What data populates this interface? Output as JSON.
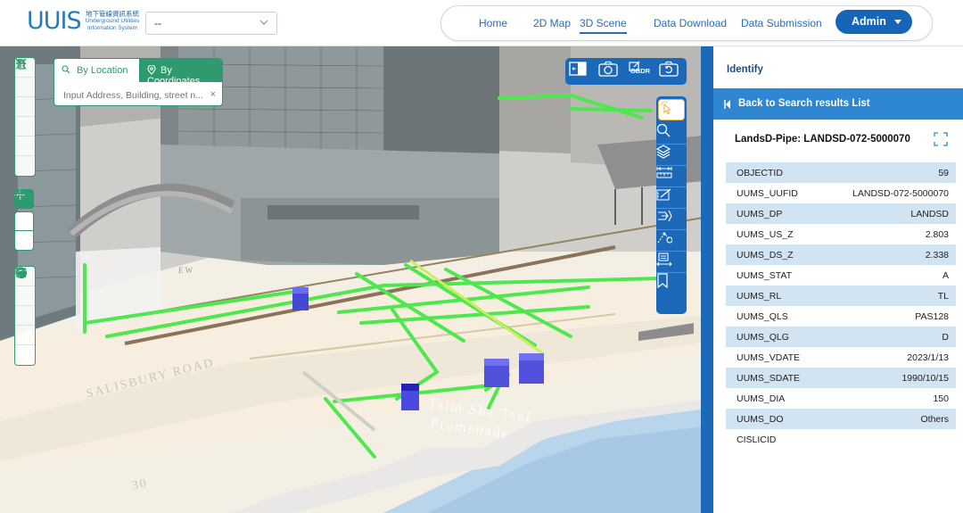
{
  "header": {
    "logo": {
      "mark": "UUIS",
      "cn": "地下管線資訊系統",
      "en1": "Underground Utilities",
      "en2": "Information System"
    },
    "project_select": {
      "value": "--"
    },
    "nav": {
      "home": "Home",
      "map2d": "2D Map",
      "scene3d": "3D Scene",
      "download": "Data Download",
      "submission": "Data Submission"
    },
    "user_button": "Admin"
  },
  "search": {
    "tab_location": "By Location",
    "tab_coordinates": "By Coordinates",
    "placeholder": "Input Address, Building, street n...",
    "clear": "×"
  },
  "top_tools": {
    "gbdr_label": "GBDR"
  },
  "map_labels": {
    "salisbury": "SALISBURY ROAD",
    "promenade1": "Tsim Sha Tsui",
    "promenade2": "Promenade",
    "num30": "30",
    "ew": "EW"
  },
  "panel": {
    "title": "Identify",
    "back": "Back to Search results List",
    "feature_title": "LandsD-Pipe: LANDSD-072-5000070",
    "attributes": [
      {
        "key": "OBJECTID",
        "value": "59"
      },
      {
        "key": "UUMS_UUFID",
        "value": "LANDSD-072-5000070"
      },
      {
        "key": "UUMS_DP",
        "value": "LANDSD"
      },
      {
        "key": "UUMS_US_Z",
        "value": "2.803"
      },
      {
        "key": "UUMS_DS_Z",
        "value": "2.338"
      },
      {
        "key": "UUMS_STAT",
        "value": "A"
      },
      {
        "key": "UUMS_RL",
        "value": "TL"
      },
      {
        "key": "UUMS_QLS",
        "value": "PAS128"
      },
      {
        "key": "UUMS_QLG",
        "value": "D"
      },
      {
        "key": "UUMS_VDATE",
        "value": "2023/1/13"
      },
      {
        "key": "UUMS_SDATE",
        "value": "1990/10/15"
      },
      {
        "key": "UUMS_DIA",
        "value": "150"
      },
      {
        "key": "UUMS_DO",
        "value": "Others"
      },
      {
        "key": "CISLICID",
        "value": ""
      }
    ]
  },
  "colors": {
    "brand": "#1c69b9",
    "accent_green": "#2f9a6f",
    "pipe_green": "#4ee84e",
    "highlight": "#f0b44c"
  },
  "icons": {
    "home": "home-icon",
    "zoom_in": "plus-icon",
    "zoom_out": "minus-icon",
    "redo": "redo-icon",
    "undo": "undo-icon",
    "fullextent": "expand-arrows-icon",
    "pan": "move-icon",
    "rotate": "rotate-icon",
    "compass": "compass-icon",
    "layers": "layers-icon",
    "legend": "legend-icon",
    "basemap": "basemap-icon",
    "globe": "globe-icon",
    "trash": "trash-icon"
  }
}
